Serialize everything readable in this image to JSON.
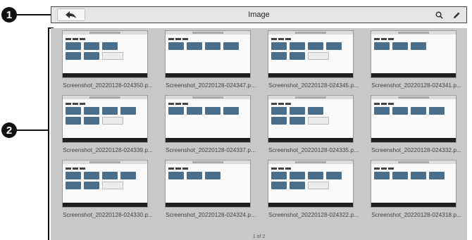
{
  "callouts": {
    "one": "1",
    "two": "2"
  },
  "header": {
    "title": "Image",
    "back_icon": "back-arrow-icon",
    "search_icon": "search-icon",
    "edit_icon": "pencil-icon"
  },
  "gallery": {
    "items": [
      {
        "caption": "Screenshot_20220128-024350.p..."
      },
      {
        "caption": "Screenshot_20220128-024347.p..."
      },
      {
        "caption": "Screenshot_20220128-024345.p..."
      },
      {
        "caption": "Screenshot_20220128-024341.p..."
      },
      {
        "caption": "Screenshot_20220128-024339.p..."
      },
      {
        "caption": "Screenshot_20220128-024337.p..."
      },
      {
        "caption": "Screenshot_20220128-024335.p..."
      },
      {
        "caption": "Screenshot_20220128-024332.p..."
      },
      {
        "caption": "Screenshot_20220128-024330.p..."
      },
      {
        "caption": "Screenshot_20220128-024324.p..."
      },
      {
        "caption": "Screenshot_20220128-024322.p..."
      },
      {
        "caption": "Screenshot_20220128-024318.p..."
      }
    ],
    "pagination": "1 of 2"
  },
  "colors": {
    "gallery_bg": "#c8c8c8",
    "toolbar_bg": "#e6e6e6",
    "tile_accent": "#4a6f8c"
  }
}
